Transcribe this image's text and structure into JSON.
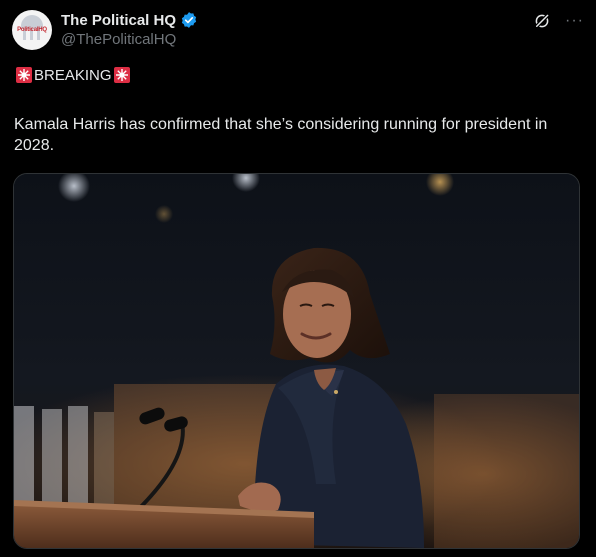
{
  "tweet": {
    "display_name": "The Political HQ",
    "handle": "@ThePoliticalHQ",
    "avatar_text": "PoliticalHQ",
    "breaking_label": "BREAKING",
    "text": "Kamala Harris has confirmed that she’s considering running for president in 2028."
  },
  "icons": {
    "verified": "verified-badge-icon",
    "grok": "grok-icon",
    "more": "more-options-icon",
    "siren": "police-siren-emoji"
  },
  "colors": {
    "background": "#000000",
    "text": "#e7e9ea",
    "secondary_text": "#71767b",
    "verified_blue": "#1d9bf0",
    "border": "#2f3336"
  }
}
